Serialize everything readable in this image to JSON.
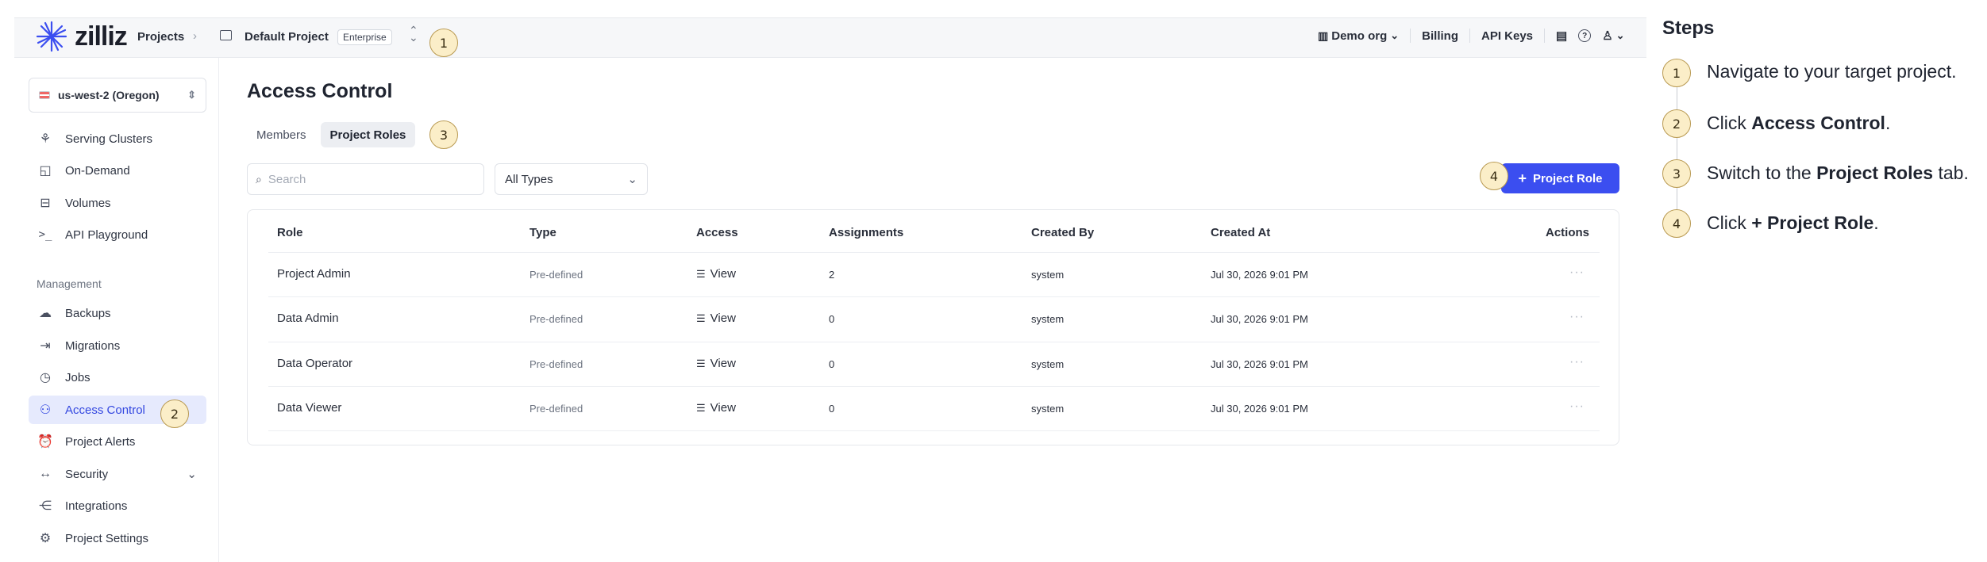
{
  "topbar": {
    "logo": "zilliz",
    "projects": "Projects",
    "project_name": "Default Project",
    "plan_badge": "Enterprise",
    "org": "Demo org",
    "billing": "Billing",
    "api_keys": "API Keys"
  },
  "sidebar": {
    "region": "us-west-2 (Oregon)",
    "items": [
      {
        "label": "Serving Clusters",
        "icon": "clusters-icon"
      },
      {
        "label": "On-Demand",
        "icon": "on-demand-icon"
      },
      {
        "label": "Volumes",
        "icon": "volumes-icon"
      },
      {
        "label": "API Playground",
        "icon": "terminal-icon"
      }
    ],
    "management_label": "Management",
    "management_items": [
      {
        "label": "Backups",
        "icon": "cloud-upload-icon"
      },
      {
        "label": "Migrations",
        "icon": "migrate-icon"
      },
      {
        "label": "Jobs",
        "icon": "history-icon"
      },
      {
        "label": "Access Control",
        "icon": "users-icon",
        "active": true
      },
      {
        "label": "Project Alerts",
        "icon": "alarm-icon"
      },
      {
        "label": "Security",
        "icon": "arrows-icon"
      },
      {
        "label": "Integrations",
        "icon": "share-icon"
      },
      {
        "label": "Project Settings",
        "icon": "gear-icon"
      }
    ]
  },
  "main": {
    "title": "Access Control",
    "tabs": [
      "Members",
      "Project Roles"
    ],
    "search_placeholder": "Search",
    "type_filter": "All Types",
    "add_button": "Project Role",
    "columns": [
      "Role",
      "Type",
      "Access",
      "Assignments",
      "Created By",
      "Created At",
      "Actions"
    ],
    "rows": [
      {
        "role": "Project Admin",
        "type": "Pre-defined",
        "access": "View",
        "assignments": "2",
        "created_by": "system",
        "created_at": "Jul 30, 2026 9:01 PM"
      },
      {
        "role": "Data Admin",
        "type": "Pre-defined",
        "access": "View",
        "assignments": "0",
        "created_by": "system",
        "created_at": "Jul 30, 2026 9:01 PM"
      },
      {
        "role": "Data Operator",
        "type": "Pre-defined",
        "access": "View",
        "assignments": "0",
        "created_by": "system",
        "created_at": "Jul 30, 2026 9:01 PM"
      },
      {
        "role": "Data Viewer",
        "type": "Pre-defined",
        "access": "View",
        "assignments": "0",
        "created_by": "system",
        "created_at": "Jul 30, 2026 9:01 PM"
      }
    ],
    "actions_glyph": "···"
  },
  "callouts": [
    "1",
    "2",
    "3",
    "4"
  ],
  "steps": {
    "title": "Steps",
    "items": [
      {
        "num": "1",
        "pre": "Navigate to your target project.",
        "bold": "",
        "post": ""
      },
      {
        "num": "2",
        "pre": "Click ",
        "bold": "Access Control",
        "post": "."
      },
      {
        "num": "3",
        "pre": "Switch to the ",
        "bold": "Project Roles",
        "post": " tab."
      },
      {
        "num": "4",
        "pre": "Click ",
        "bold": "+ Project Role",
        "post": "."
      }
    ]
  }
}
